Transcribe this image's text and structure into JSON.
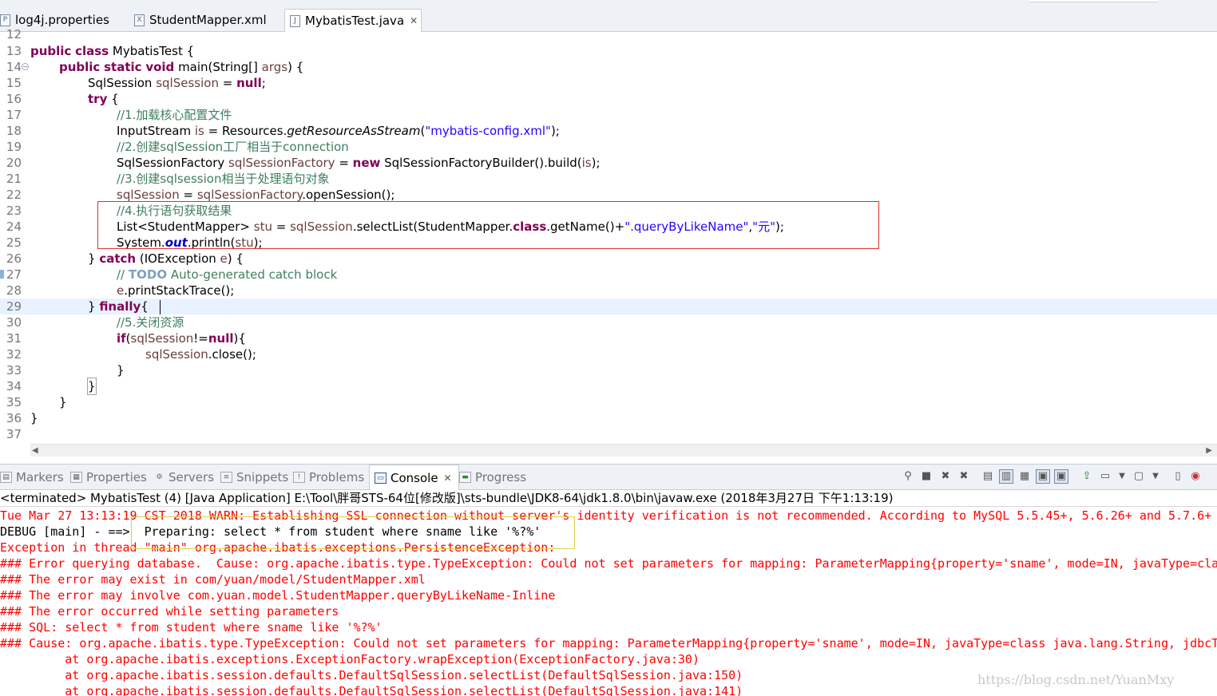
{
  "editor_tabs": [
    {
      "label": "log4j.properties",
      "icon": "properties-file-icon"
    },
    {
      "label": "StudentMapper.xml",
      "icon": "xml-file-icon"
    },
    {
      "label": "MybatisTest.java",
      "icon": "java-file-icon",
      "active": true
    }
  ],
  "editor": {
    "line_numbers": [
      "12",
      "13",
      "14",
      "15",
      "16",
      "17",
      "18",
      "19",
      "20",
      "21",
      "22",
      "23",
      "24",
      "25",
      "26",
      "27",
      "28",
      "29",
      "30",
      "31",
      "32",
      "33",
      "34",
      "35",
      "36",
      "37"
    ],
    "code": {
      "l12": "",
      "l13": [
        "public",
        " ",
        "class",
        " MybatisTest {"
      ],
      "l14": [
        "public",
        " ",
        "static",
        " ",
        "void",
        " main(String[] ",
        "args",
        ") {"
      ],
      "l15": [
        "SqlSession ",
        "sqlSession",
        " = ",
        "null",
        ";"
      ],
      "l16": [
        "try",
        " {"
      ],
      "l17": "//1.加载核心配置文件",
      "l18": [
        "InputStream ",
        "is",
        " = Resources.",
        "getResourceAsStream",
        "(",
        "\"mybatis-config.xml\"",
        ");"
      ],
      "l19": "//2.创建sqlSession工厂相当于connection",
      "l20": [
        "SqlSessionFactory ",
        "sqlSessionFactory",
        " = ",
        "new",
        " SqlSessionFactoryBuilder().build(",
        "is",
        ");"
      ],
      "l21": "//3.创建sqlsession相当于处理语句对象",
      "l22": [
        "sqlSession",
        " = ",
        "sqlSessionFactory",
        ".openSession();"
      ],
      "l23": "//4.执行语句获取结果",
      "l24": [
        "List<StudentMapper> ",
        "stu",
        " = ",
        "sqlSession",
        ".selectList(StudentMapper.",
        "class",
        ".getName()+",
        "\".queryByLikeName\"",
        ",",
        "\"元\"",
        ");"
      ],
      "l25": [
        "System.",
        "out",
        ".println(",
        "stu",
        ");"
      ],
      "l26": [
        "} ",
        "catch",
        " (IOException ",
        "e",
        ") {"
      ],
      "l27": [
        "// ",
        "TODO",
        " Auto-generated catch block"
      ],
      "l28": [
        "e",
        ".printStackTrace();"
      ],
      "l29": [
        "} ",
        "finally",
        "{"
      ],
      "l30": "//5.关闭资源",
      "l31": [
        "if",
        "(",
        "sqlSession",
        "!=",
        "null",
        "){"
      ],
      "l32": [
        "sqlSession",
        ".close();"
      ],
      "l33": "}",
      "l34": "}",
      "l35": "}",
      "l36": "}",
      "l37": ""
    }
  },
  "panel_tabs": [
    {
      "label": "Markers",
      "icon": "markers-icon"
    },
    {
      "label": "Properties",
      "icon": "properties-icon"
    },
    {
      "label": "Servers",
      "icon": "servers-icon"
    },
    {
      "label": "Snippets",
      "icon": "snippets-icon"
    },
    {
      "label": "Problems",
      "icon": "problems-icon"
    },
    {
      "label": "Console",
      "icon": "console-icon",
      "active": true
    },
    {
      "label": "Progress",
      "icon": "progress-icon"
    }
  ],
  "console": {
    "header": "<terminated> MybatisTest (4) [Java Application] E:\\Tool\\胖哥STS-64位[修改版]\\sts-bundle\\JDK8-64\\jdk1.8.0\\bin\\javaw.exe (2018年3月27日 下午1:13:19)",
    "lines": [
      {
        "text": "Tue Mar 27 13:13:19 CST 2018 WARN: Establishing SSL connection without server's identity verification is not recommended. According to MySQL 5.5.45+, 5.6.26+ and 5.7.6+ r",
        "kind": "err"
      },
      {
        "text": "DEBUG [main] - ==>  Preparing: select * from student where sname like '%?%' ",
        "kind": "out"
      },
      {
        "text": "Exception in thread \"main\" org.apache.ibatis.exceptions.PersistenceException: ",
        "kind": "err"
      },
      {
        "text": "### Error querying database.  Cause: org.apache.ibatis.type.TypeException: Could not set parameters for mapping: ParameterMapping{property='sname', mode=IN, javaType=clas",
        "kind": "err"
      },
      {
        "text": "### The error may exist in com/yuan/model/StudentMapper.xml",
        "kind": "err"
      },
      {
        "text": "### The error may involve com.yuan.model.StudentMapper.queryByLikeName-Inline",
        "kind": "err"
      },
      {
        "text": "### The error occurred while setting parameters",
        "kind": "err"
      },
      {
        "text": "### SQL: select * from student where sname like '%?%'",
        "kind": "err"
      },
      {
        "text": "### Cause: org.apache.ibatis.type.TypeException: Could not set parameters for mapping: ParameterMapping{property='sname', mode=IN, javaType=class java.lang.String, jdbcTy",
        "kind": "err"
      },
      {
        "text": "\tat org.apache.ibatis.exceptions.ExceptionFactory.wrapException(ExceptionFactory.java:30)",
        "kind": "err"
      },
      {
        "text": "\tat org.apache.ibatis.session.defaults.DefaultSqlSession.selectList(DefaultSqlSession.java:150)",
        "kind": "err"
      },
      {
        "text": "\tat org.apache.ibatis.session.defaults.DefaultSqlSession.selectList(DefaultSqlSession.java:141)",
        "kind": "err"
      }
    ]
  },
  "watermark": "https://blog.csdn.net/YuanMxy",
  "colors": {
    "keyword": "#7f0055",
    "comment": "#3f7f5f",
    "string": "#2a00ff",
    "field": "#0000c0",
    "local_var": "#6a3e3e",
    "console_error": "#ff0000",
    "highlight_box": "#e03030",
    "debug_box": "#d8d24a"
  }
}
